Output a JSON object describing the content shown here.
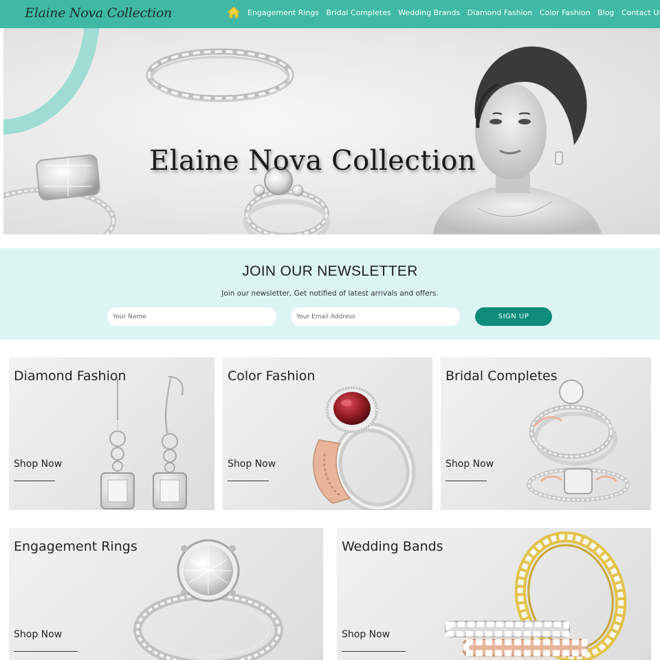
{
  "header": {
    "logo_text": "Elaine Nova Collection",
    "logo_icon": "butterfly-logo-icon",
    "home_icon": "home-icon",
    "nav": [
      {
        "label": "Engagement Rings"
      },
      {
        "label": "Bridal Completes"
      },
      {
        "label": "Wedding Brands"
      },
      {
        "label": "Diamond Fashion"
      },
      {
        "label": "Color Fashion"
      },
      {
        "label": "Blog"
      },
      {
        "label": "Contact Us"
      }
    ]
  },
  "hero": {
    "title": "Elaine Nova Collection"
  },
  "newsletter": {
    "title": "JOIN OUR NEWSLETTER",
    "subtitle": "Join our newsletter, Get notified of latest arrivals and offers.",
    "name_placeholder": "Your Name",
    "email_placeholder": "Your Email Address",
    "signup_label": "SIGN UP"
  },
  "categories": [
    {
      "title": "Diamond Fashion",
      "cta": "Shop Now"
    },
    {
      "title": "Color Fashion",
      "cta": "Shop Now"
    },
    {
      "title": "Bridal Completes",
      "cta": "Shop Now"
    },
    {
      "title": "Engagement Rings",
      "cta": "Shop Now"
    },
    {
      "title": "Wedding Bands",
      "cta": "Shop Now"
    }
  ],
  "colors": {
    "header_bg": "#3fb9a6",
    "newsletter_bg": "#dcf5f3",
    "button_bg": "#0e8c7a",
    "accent_arc": "#9fdcd3",
    "gemstone": "#8e1a22",
    "gold": "#e3c34a",
    "rose_gold": "#e8b49a"
  }
}
